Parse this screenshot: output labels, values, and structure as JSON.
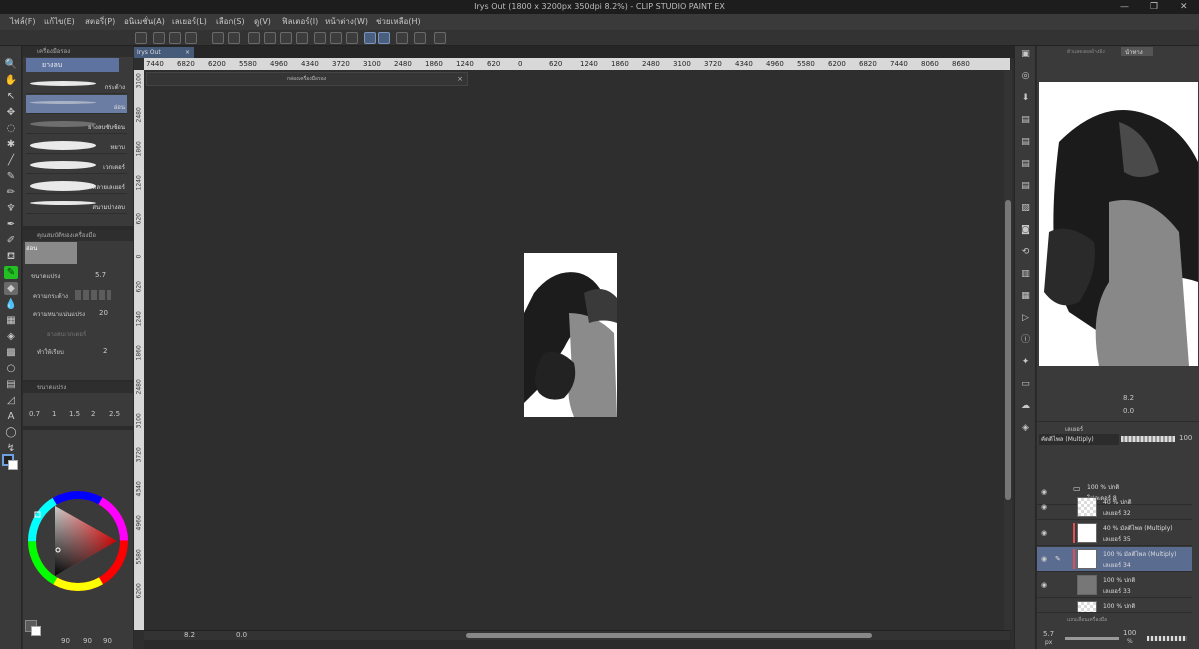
{
  "window": {
    "title": "Irys Out (1800 x 3200px 350dpi 8.2%) - CLIP STUDIO PAINT EX",
    "controls": [
      "—",
      "❐",
      "✕"
    ]
  },
  "menu": [
    "ไฟล์(F)",
    "แก้ไข(E)",
    "สตอรี่(P)",
    "อนิเมชั่น(A)",
    "เลเยอร์(L)",
    "เลือก(S)",
    "ดู(V)",
    "ฟิลเตอร์(I)",
    "หน้าต่าง(W)",
    "ช่วยเหลือ(H)"
  ],
  "subtool": {
    "header": "เครื่องมือรอง",
    "group_tab": "ยางลบ",
    "brushes": [
      {
        "label": "กระด้าง"
      },
      {
        "label": "อ่อน"
      },
      {
        "label": "ยางลบซับซ้อน"
      },
      {
        "label": "หยาบ"
      },
      {
        "label": "เวกเตอร์"
      },
      {
        "label": "หลายเลเยอร์"
      },
      {
        "label": "สนามปางลบ"
      }
    ]
  },
  "tool_property": {
    "header": "คุณสมบัติของเครื่องมือ",
    "preset": "อ่อน",
    "brush_size_label": "ขนาดแปรง",
    "brush_size": "5.7",
    "hardness_label": "ความกระด้าง",
    "density_label": "ความหนาแน่นแปรง",
    "density": "20",
    "vector_label": "ยางลบเวกเตอร์",
    "aa_label": "ทำให้เรียบ",
    "aa_value": "2"
  },
  "brush_size_panel": {
    "header": "ขนาดแปรง",
    "sizes": [
      "0.7",
      "1",
      "1.5",
      "2",
      "2.5"
    ]
  },
  "color": {
    "r": "90",
    "g": "90",
    "b": "90",
    "hue_marker": "#ff0000"
  },
  "canvas": {
    "tab_label": "Irys Out",
    "ruler_labels": [
      "7440",
      "6820",
      "6200",
      "5580",
      "4960",
      "4340",
      "3720",
      "3100",
      "2480",
      "1860",
      "1240",
      "620",
      "0",
      "620",
      "1240",
      "1860",
      "2480",
      "3100",
      "3720",
      "4340",
      "4960",
      "5580",
      "6200",
      "6820",
      "7440",
      "8060",
      "8680"
    ],
    "vruler_labels": [
      "3100",
      "2480",
      "1860",
      "1240",
      "620",
      "0",
      "620",
      "1240",
      "1860",
      "2480",
      "3100",
      "3720",
      "4340",
      "4960",
      "5580",
      "6200"
    ],
    "mini_window_title": "กล่องเครื่องมือรอง",
    "zoom": "8.2",
    "rotation": "0.0"
  },
  "navigator": {
    "tabs": [
      "ตัวแสดงผลอ้างอิง",
      "นำทาง"
    ],
    "zoom": "8.2",
    "rotation": "0.0"
  },
  "layers": {
    "header": "เลเยอร์",
    "blend_mode": "คัดติไพล (Multiply)",
    "opacity": "100",
    "items": [
      {
        "mode": "100 % ปกติ",
        "name": "โฟลเดอร์ 8",
        "kind": "folder"
      },
      {
        "mode": "40 % ปกติ",
        "name": "เลเยอร์ 32",
        "kind": "checker"
      },
      {
        "mode": "40 % มัลติไพล (Multiply)",
        "name": "เลเยอร์ 35",
        "kind": "art"
      },
      {
        "mode": "100 % มัลติไพล (Multiply)",
        "name": "เลเยอร์ 34",
        "kind": "art",
        "selected": true
      },
      {
        "mode": "100 % ปกติ",
        "name": "เลเยอร์ 33",
        "kind": "art2"
      },
      {
        "mode": "100 % ปกติ",
        "name": "",
        "kind": "checker"
      }
    ]
  },
  "bottom_panel": {
    "header": "แถบเลื่อนเครื่องมือ",
    "size": "5.7",
    "unit": "px",
    "opacity": "100",
    "pct": "%"
  }
}
